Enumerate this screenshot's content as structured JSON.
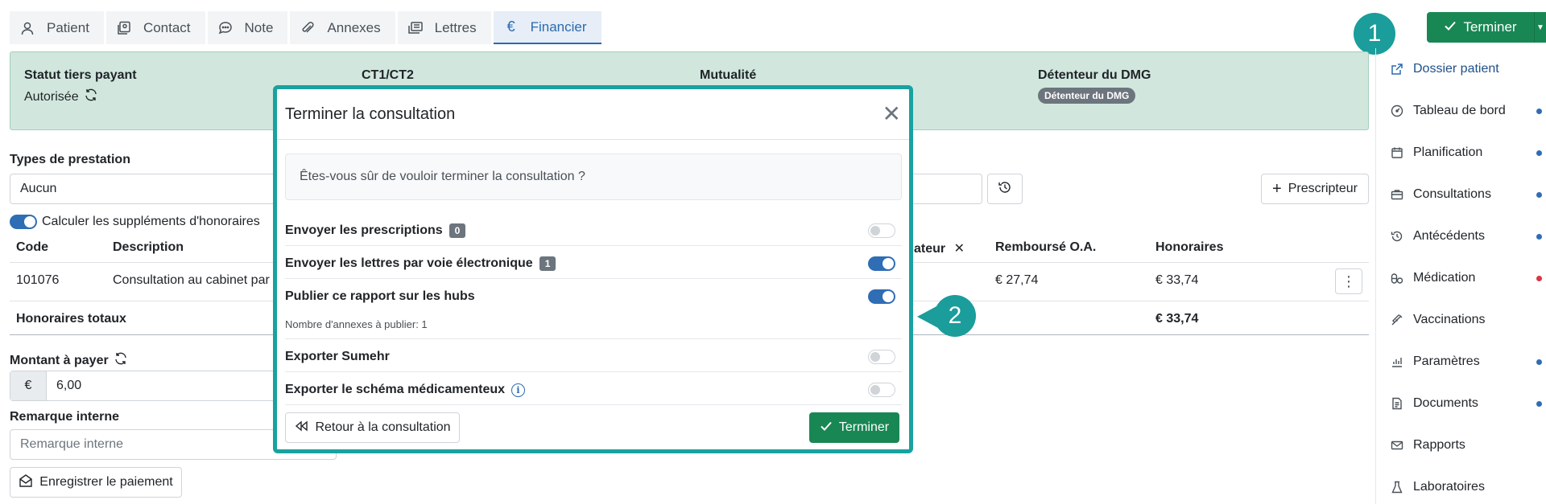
{
  "tabs": [
    {
      "label": "Patient",
      "icon": "user-icon"
    },
    {
      "label": "Contact",
      "icon": "contact-card-icon"
    },
    {
      "label": "Note",
      "icon": "speech-bubble-icon"
    },
    {
      "label": "Annexes",
      "icon": "paperclip-icon"
    },
    {
      "label": "Lettres",
      "icon": "letters-icon"
    },
    {
      "label": "Financier",
      "icon": "euro-icon",
      "glyph": "€",
      "active": true
    }
  ],
  "header": {
    "terminer_label": "Terminer"
  },
  "callouts": {
    "one": "1",
    "two": "2"
  },
  "banner": {
    "tiers_payant_label": "Statut tiers payant",
    "tiers_payant_value": "Autorisée",
    "ct_label": "CT1/CT2",
    "mutualite_label": "Mutualité",
    "dmg_label": "Détenteur du DMG",
    "dmg_badge": "Détenteur du DMG"
  },
  "form": {
    "types_label": "Types de prestation",
    "types_value": "Aucun",
    "supplements_label": "Calculer les suppléments d'honoraires",
    "prescripteur_label": "Prescripteur",
    "table": {
      "headers": {
        "code": "Code",
        "description": "Description",
        "prestataire_tail": "ateur",
        "rembourse": "Remboursé O.A.",
        "honoraires": "Honoraires"
      },
      "row": {
        "code": "101076",
        "description": "Consultation au cabinet par",
        "rembourse": "€ 27,74",
        "honoraires": "€ 33,74"
      },
      "total_label": "Honoraires totaux",
      "total_value": "€ 33,74"
    },
    "montant_label": "Montant à payer",
    "montant_currency": "€",
    "montant_value": "6,00",
    "remarque_label": "Remarque interne",
    "remarque_placeholder": "Remarque interne",
    "enregistrer_label": "Enregistrer le paiement"
  },
  "sidebar": {
    "items": [
      {
        "label": "Dossier patient",
        "icon": "external-link-icon",
        "dot": null
      },
      {
        "label": "Tableau de bord",
        "icon": "dashboard-icon",
        "dot": "blue"
      },
      {
        "label": "Planification",
        "icon": "calendar-icon",
        "dot": "blue"
      },
      {
        "label": "Consultations",
        "icon": "briefcase-icon",
        "dot": "blue"
      },
      {
        "label": "Antécédents",
        "icon": "history-icon",
        "dot": "blue"
      },
      {
        "label": "Médication",
        "icon": "pills-icon",
        "dot": "red"
      },
      {
        "label": "Vaccinations",
        "icon": "syringe-icon",
        "dot": null
      },
      {
        "label": "Paramètres",
        "icon": "chart-icon",
        "dot": "blue"
      },
      {
        "label": "Documents",
        "icon": "document-icon",
        "dot": "blue"
      },
      {
        "label": "Rapports",
        "icon": "mail-icon",
        "dot": null
      },
      {
        "label": "Laboratoires",
        "icon": "flask-icon",
        "dot": null
      }
    ]
  },
  "modal": {
    "title": "Terminer la consultation",
    "question": "Êtes-vous sûr de vouloir terminer la consultation ?",
    "options": [
      {
        "label": "Envoyer les prescriptions",
        "count": "0",
        "enabled": false
      },
      {
        "label": "Envoyer les lettres par voie électronique",
        "count": "1",
        "enabled": true
      },
      {
        "label": "Publier ce rapport sur les hubs",
        "enabled": true
      },
      {
        "label": "Exporter Sumehr",
        "enabled": false
      },
      {
        "label": "Exporter le schéma médicamenteux",
        "enabled": false
      }
    ],
    "annexes_note": "Nombre d'annexes à publier: 1",
    "back_label": "Retour à la consultation",
    "confirm_label": "Terminer"
  },
  "colors": {
    "green": "#198754",
    "teal": "#18a2a0",
    "blue": "#2f6db5",
    "banner_bg": "#d1e7dd"
  }
}
